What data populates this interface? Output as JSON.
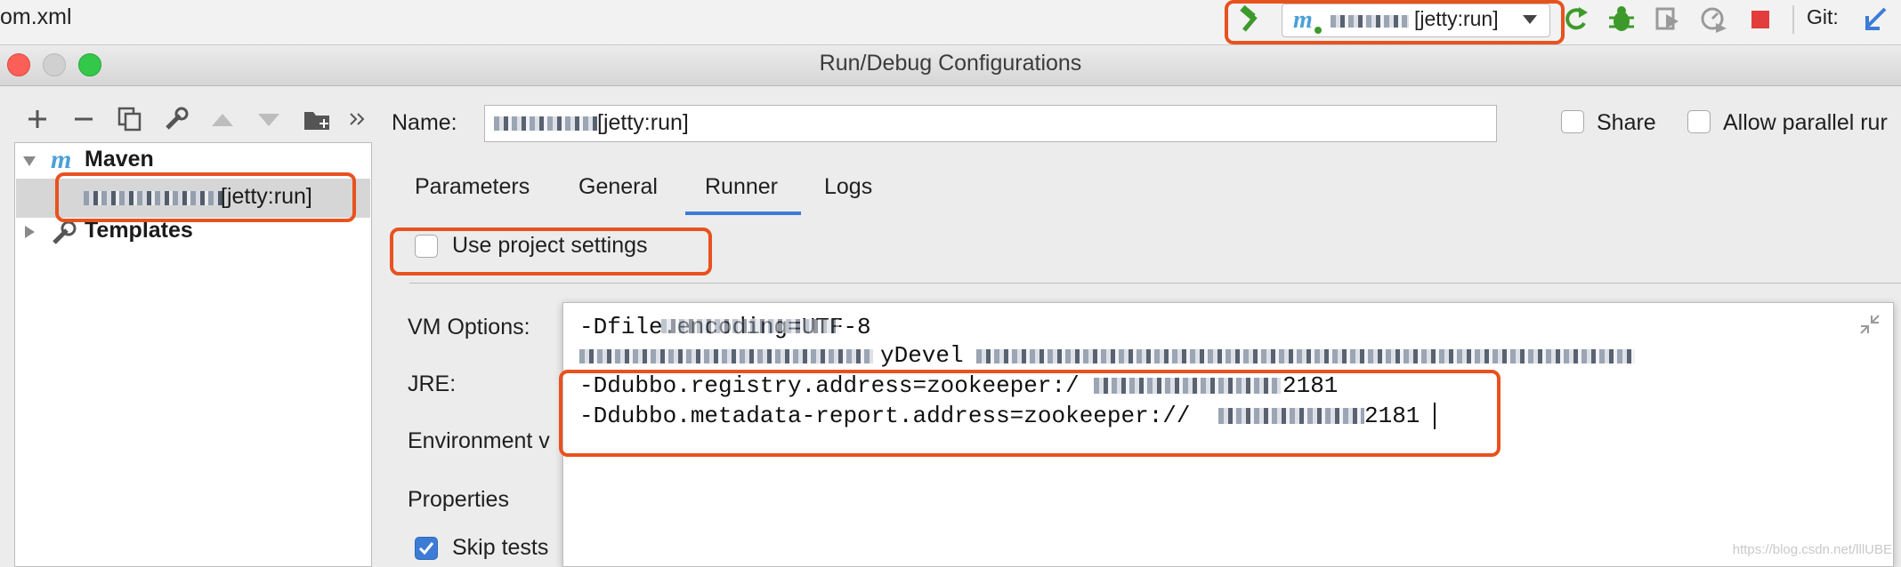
{
  "toolbar": {
    "file_name": "om.xml",
    "run_config_label": "[jetty:run]",
    "git_label": "Git:",
    "icons": [
      "build-hammer-icon",
      "maven-icon",
      "rerun-icon",
      "debug-icon",
      "coverage-icon",
      "profile-icon",
      "stop-icon",
      "git-update-icon"
    ],
    "colors": {
      "accent_red": "#e8521f",
      "run_green": "#3c9a2b",
      "stop_red": "#e23c3c"
    }
  },
  "dialog": {
    "title": "Run/Debug Configurations"
  },
  "tree": {
    "maven_label": "Maven",
    "config_label": "[jetty:run]",
    "templates_label": "Templates"
  },
  "form": {
    "name_label": "Name:",
    "name_value": "[jetty:run]",
    "share_label": "Share",
    "parallel_label": "Allow parallel rur",
    "tabs": [
      "Parameters",
      "General",
      "Runner",
      "Logs"
    ],
    "active_tab": "Runner",
    "use_project_settings": "Use project settings",
    "vm_options_label": "VM Options:",
    "jre_label": "JRE:",
    "env_label": "Environment v",
    "properties_label": "Properties",
    "skip_tests_label": "Skip tests"
  },
  "vm_options": {
    "line1": "-Dfile.encoding=UTF-8",
    "line2_mid": "yDevel",
    "line3_prefix": "-Ddubbo.registry.address=zookeeper:/",
    "line3_suffix": "2181",
    "line4_prefix": "-Ddubbo.metadata-report.address=zookeeper://",
    "line4_suffix": "2181"
  },
  "watermark": "https://blog.csdn.net/lllUBE"
}
